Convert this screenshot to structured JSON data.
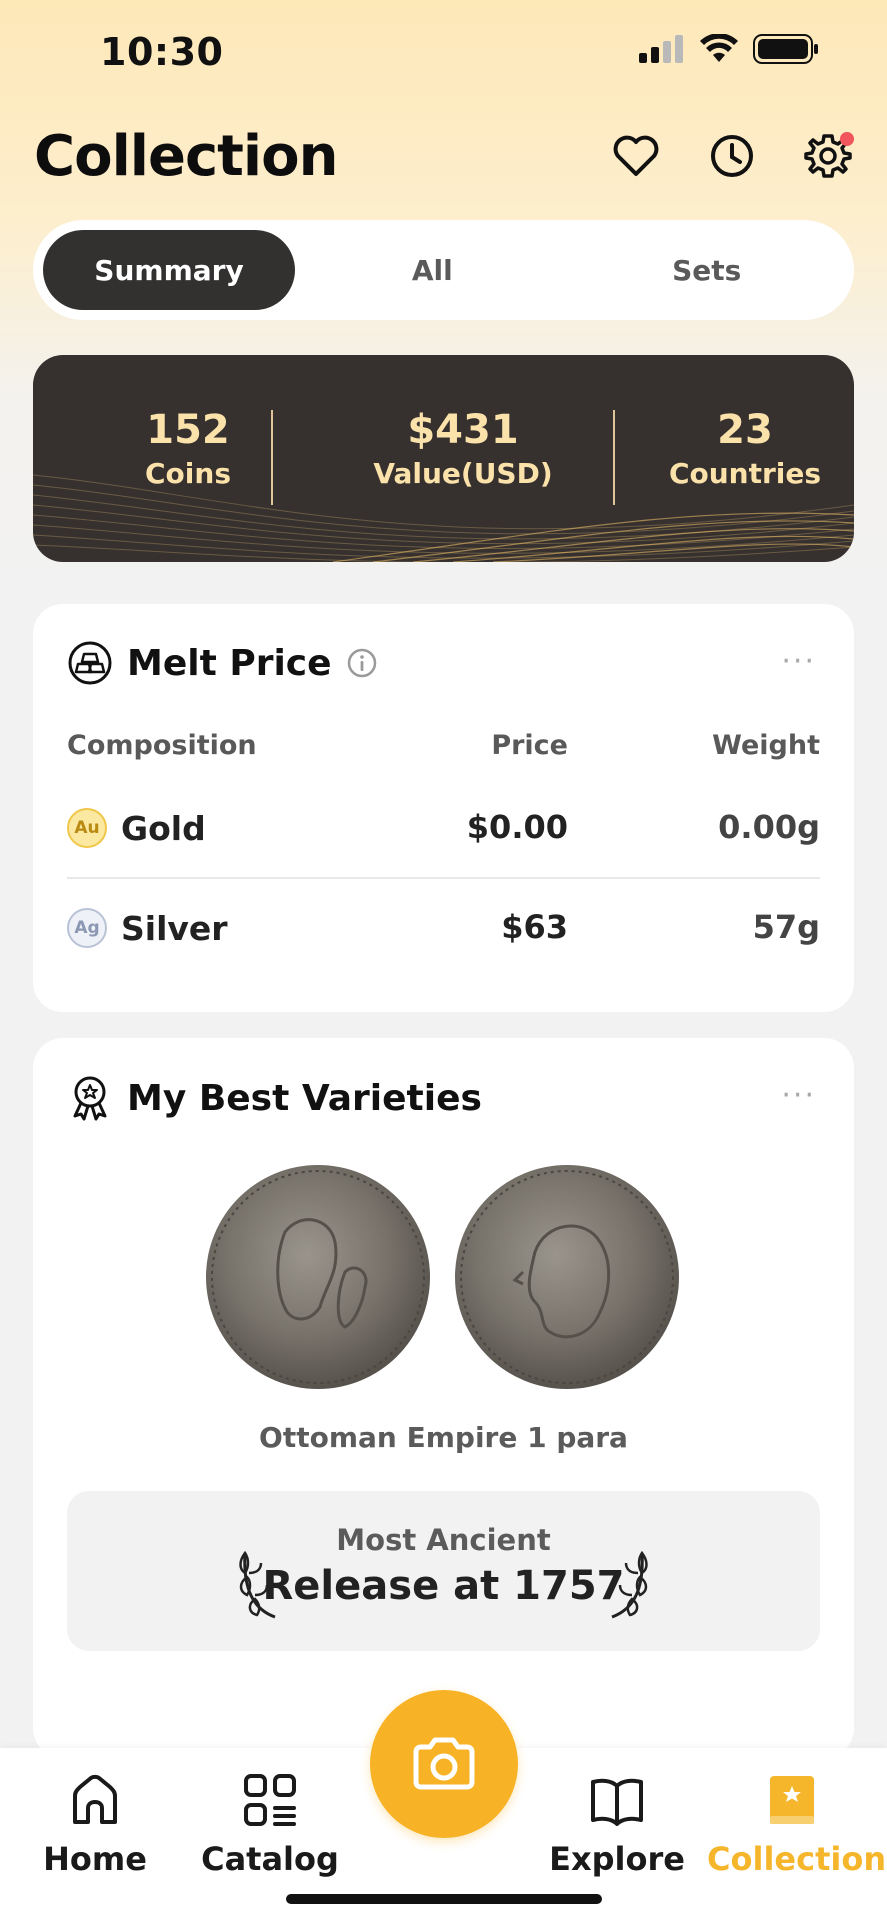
{
  "status_bar": {
    "time": "10:30"
  },
  "header": {
    "title": "Collection"
  },
  "tabs": [
    {
      "label": "Summary",
      "active": true
    },
    {
      "label": "All",
      "active": false
    },
    {
      "label": "Sets",
      "active": false
    }
  ],
  "stats": [
    {
      "value": "152",
      "label": "Coins"
    },
    {
      "value": "$431",
      "label": "Value(USD)"
    },
    {
      "value": "23",
      "label": "Countries"
    }
  ],
  "melt_price": {
    "title": "Melt Price",
    "more": "···",
    "columns": {
      "composition": "Composition",
      "price": "Price",
      "weight": "Weight"
    },
    "rows": [
      {
        "badge": "Au",
        "name": "Gold",
        "price": "$0.00",
        "weight": "0.00g"
      },
      {
        "badge": "Ag",
        "name": "Silver",
        "price": "$63",
        "weight": "57g"
      }
    ]
  },
  "best_varieties": {
    "title": "My Best Varieties",
    "more": "···",
    "coin_name": "Ottoman Empire 1 para",
    "highlight": {
      "label": "Most Ancient",
      "value": "Release at 1757"
    }
  },
  "tabbar": {
    "items": [
      {
        "label": "Home",
        "icon": "home-icon",
        "active": false
      },
      {
        "label": "Catalog",
        "icon": "catalog-icon",
        "active": false
      },
      {
        "label": "Explore",
        "icon": "book-icon",
        "active": false
      },
      {
        "label": "Collection",
        "icon": "collection-icon",
        "active": true
      }
    ],
    "camera_icon": "camera-icon"
  },
  "colors": {
    "accent": "#f7b226",
    "dark_card": "#36312f",
    "gold_text": "#fbe1aa",
    "notification": "#f0565c"
  }
}
